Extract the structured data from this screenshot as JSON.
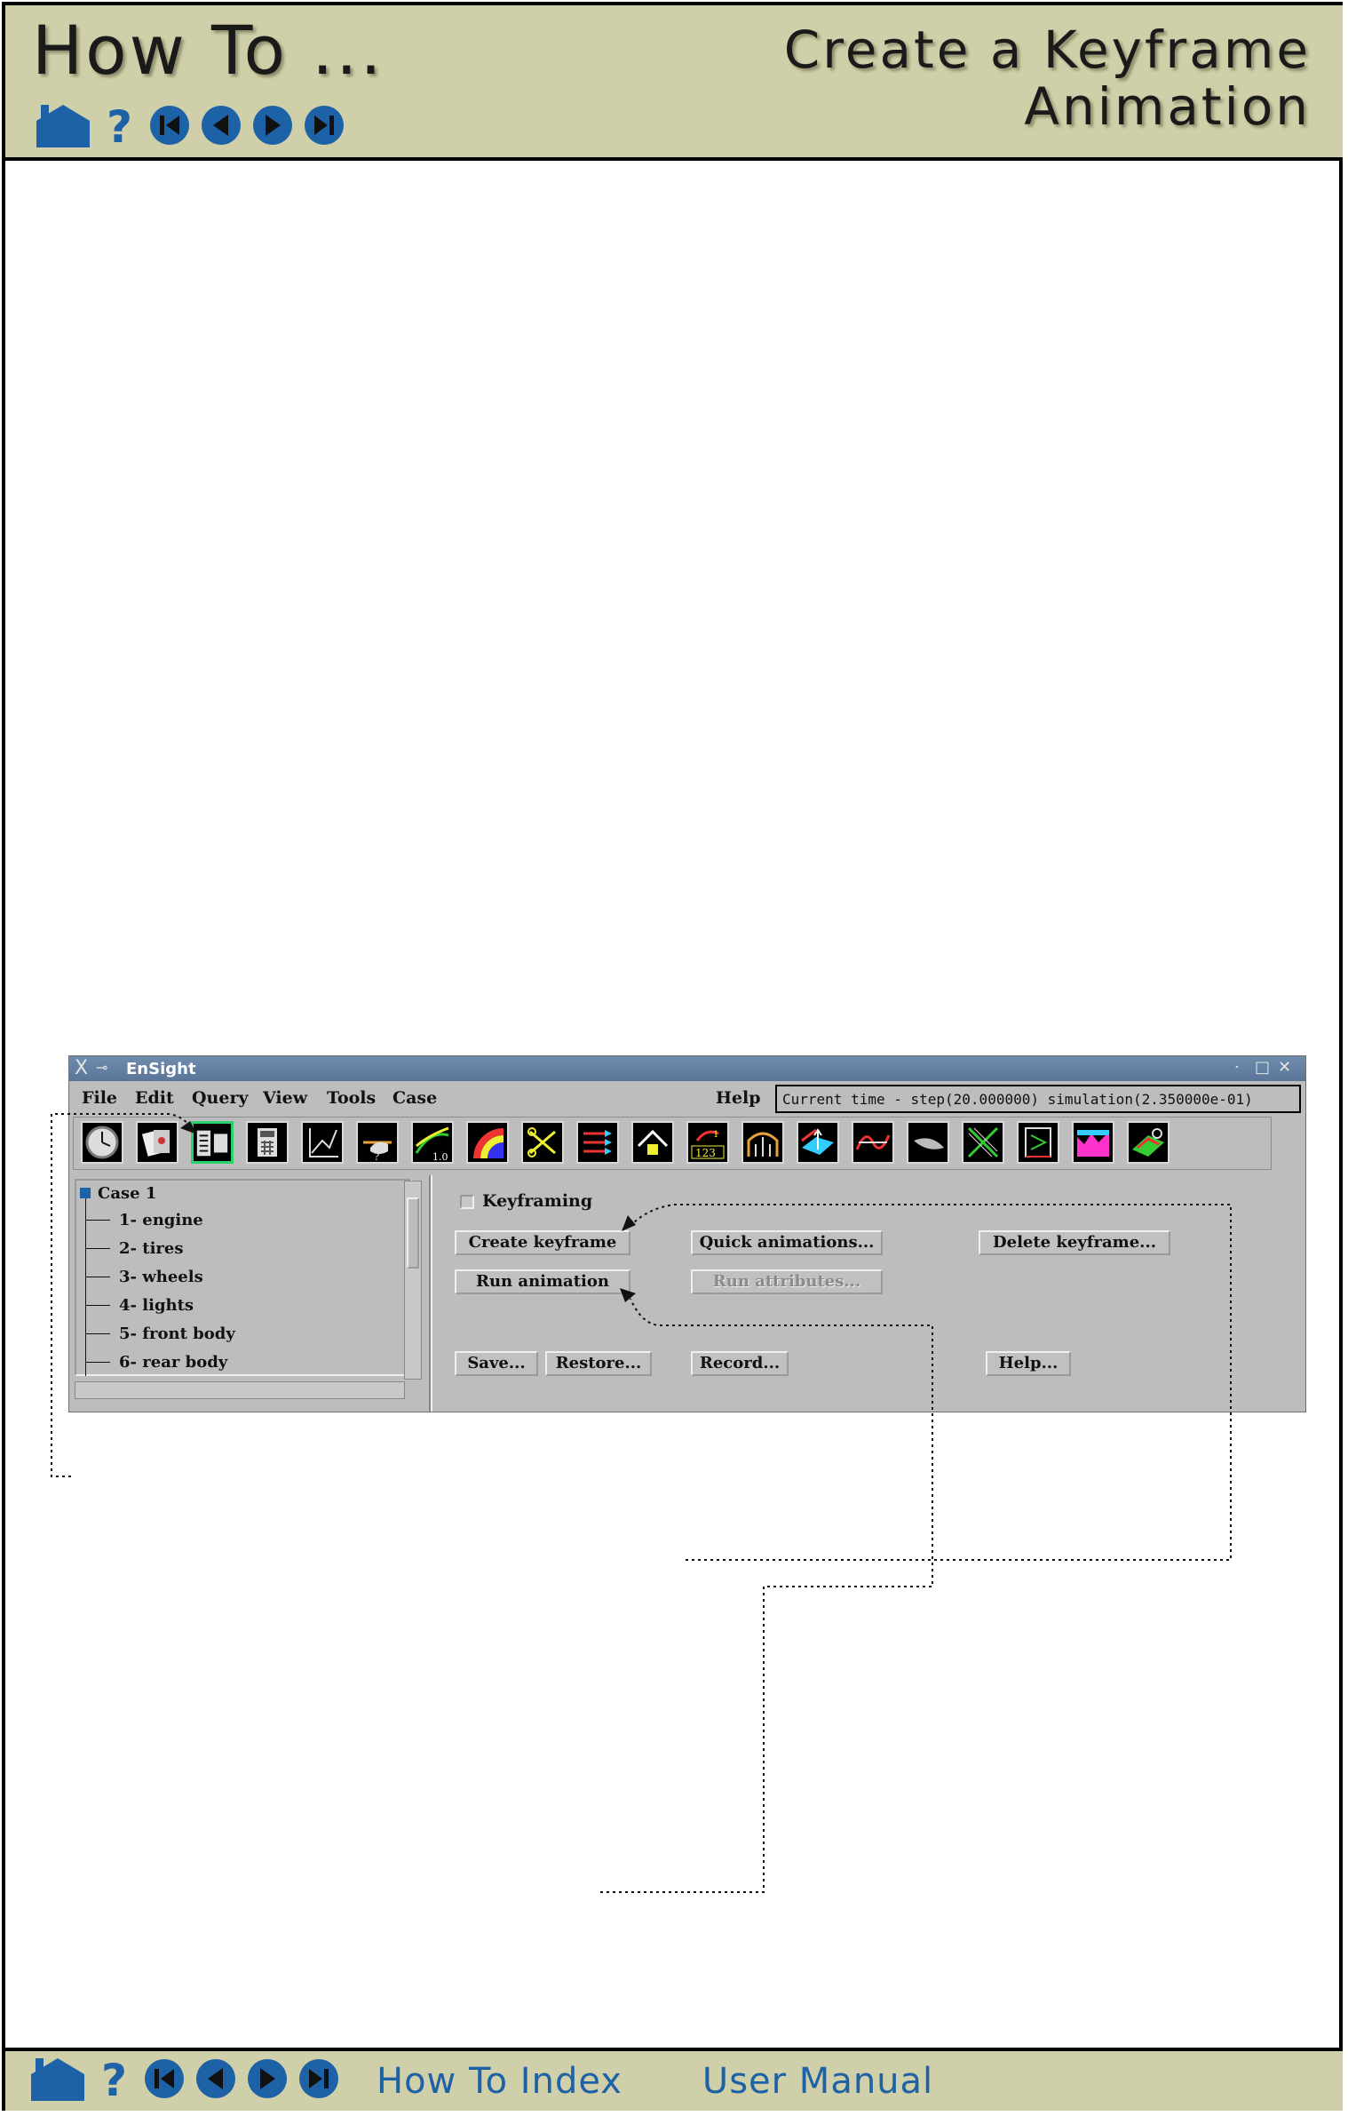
{
  "header": {
    "section": "How To ...",
    "title_line1": "Create a Keyframe",
    "title_line2": "Animation"
  },
  "nav_icons": [
    "home-icon",
    "help-icon",
    "first-page-icon",
    "previous-page-icon",
    "next-page-icon",
    "last-page-icon"
  ],
  "footer": {
    "links": [
      "How To Index",
      "User Manual"
    ]
  },
  "colors": {
    "banner": "#cfcfa9",
    "nav_blue": "#1d61a6",
    "window_gray": "#bdbdbd",
    "titlebar": "#5a7597"
  },
  "window": {
    "title": "EnSight",
    "menus": [
      "File",
      "Edit",
      "Query",
      "View",
      "Tools",
      "Case",
      "Help"
    ],
    "status": "Current time - step(20.000000) simulation(2.350000e-01)",
    "toolbar_icons": [
      "clock-icon",
      "playing-cards-icon",
      "flipbook-icon",
      "calculator-icon",
      "query-plot-icon",
      "query-hand-icon",
      "line-value-icon",
      "color-palette-icon",
      "scissors-icon",
      "vector-arrows-icon",
      "house-icon",
      "number-annotation-icon",
      "elevated-surface-icon",
      "isosurface-icon",
      "curve-icon",
      "particle-trace-icon",
      "streamline-cross-icon",
      "clip-icon",
      "profile-icon",
      "contour-3d-icon"
    ],
    "selected_tool": "flipbook-icon",
    "tree": {
      "root": "Case 1",
      "parts": [
        "1- engine",
        "2- tires",
        "3- wheels",
        "4- lights",
        "5- front body",
        "6- rear body"
      ]
    },
    "keyframing_label": "Keyframing",
    "buttons": {
      "create_keyframe": "Create keyframe",
      "quick_animations": "Quick animations...",
      "delete_keyframe": "Delete keyframe...",
      "run_animation": "Run animation",
      "run_attributes": "Run attributes...",
      "save": "Save...",
      "restore": "Restore...",
      "record": "Record...",
      "help": "Help..."
    }
  }
}
